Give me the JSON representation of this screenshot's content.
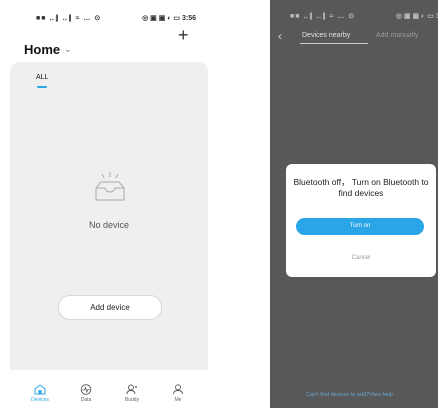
{
  "left": {
    "status": {
      "left": "■■ ‥∥ ‥∥ ≈ … ⊙",
      "right": "◎ ▣ ▣ ◐ ▭ 3:56"
    },
    "header": {
      "title": "Home",
      "dropdown_icon": "chevron-down-icon",
      "add_icon": "plus-icon"
    },
    "tabs": [
      {
        "label": "ALL",
        "active": true
      }
    ],
    "empty": {
      "icon": "empty-tray-icon",
      "message": "No device"
    },
    "add_button": "Add device",
    "nav": [
      {
        "label": "Devices",
        "icon": "home-icon",
        "active": true
      },
      {
        "label": "Data",
        "icon": "pulse-icon",
        "active": false
      },
      {
        "label": "Buddy",
        "icon": "buddy-icon",
        "active": false
      },
      {
        "label": "Me",
        "icon": "person-icon",
        "active": false
      }
    ]
  },
  "right": {
    "status": {
      "left": "■■ ‥∥ ‥∥ ≈ … ⊙",
      "right": "◎ ▣ ▣ ◐ ▭ 3:"
    },
    "header": {
      "back_icon": "chevron-left-icon",
      "tabs": [
        "Devices nearby",
        "Add manually"
      ]
    },
    "dialog": {
      "message": "Bluetooth off， Turn on Bluetooth to find devices",
      "confirm": "Turn on",
      "cancel": "Cancel"
    },
    "help_link": "Can't find devices to add?View help"
  },
  "colors": {
    "accent": "#2aa6e8",
    "overlay": "#585858",
    "content_bg": "#efefef"
  }
}
